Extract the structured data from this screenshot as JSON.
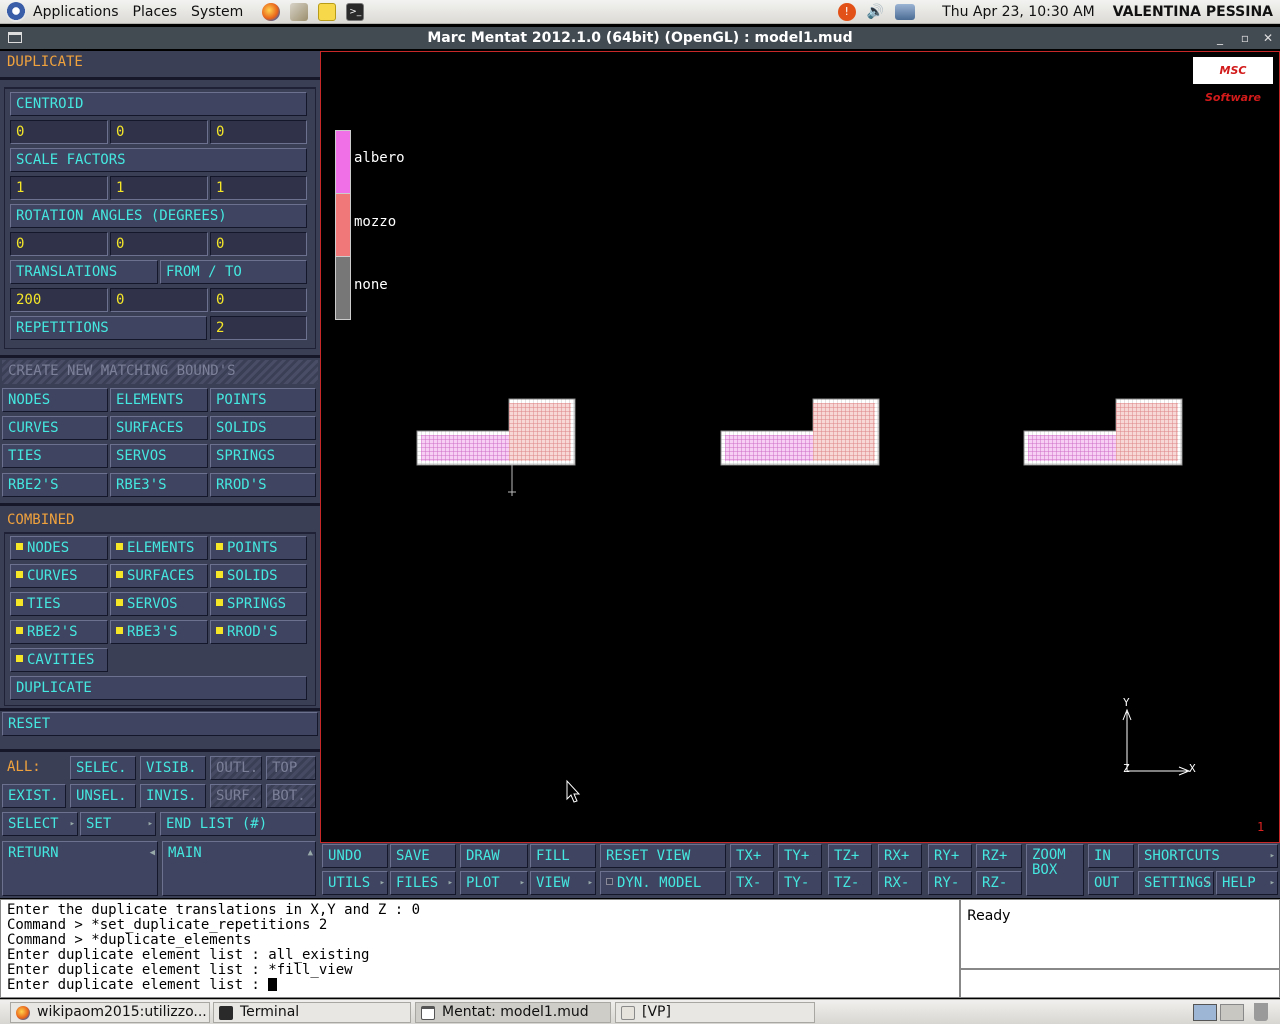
{
  "top_panel": {
    "menus": [
      "Applications",
      "Places",
      "System"
    ],
    "clock": "Thu Apr 23, 10:30 AM",
    "user": "VALENTINA PESSINA"
  },
  "window": {
    "title": "Marc Mentat 2012.1.0 (64bit) (OpenGL) : model1.mud"
  },
  "left": {
    "header": "DUPLICATE",
    "centroid_label": "CENTROID",
    "centroid": [
      "0",
      "0",
      "0"
    ],
    "scale_label": "SCALE FACTORS",
    "scale": [
      "1",
      "1",
      "1"
    ],
    "rotation_label": "ROTATION ANGLES (DEGREES)",
    "rotation": [
      "0",
      "0",
      "0"
    ],
    "translations_label": "TRANSLATIONS",
    "fromto_label": "FROM / TO",
    "translations": [
      "200",
      "0",
      "0"
    ],
    "repetitions_label": "REPETITIONS",
    "repetitions": "2",
    "create_matching": "CREATE NEW MATCHING BOUND'S",
    "entities": [
      "NODES",
      "ELEMENTS",
      "POINTS",
      "CURVES",
      "SURFACES",
      "SOLIDS",
      "TIES",
      "SERVOS",
      "SPRINGS",
      "RBE2'S",
      "RBE3'S",
      "RROD'S"
    ],
    "combined_label": "COMBINED",
    "combined": [
      "NODES",
      "ELEMENTS",
      "POINTS",
      "CURVES",
      "SURFACES",
      "SOLIDS",
      "TIES",
      "SERVOS",
      "SPRINGS",
      "RBE2'S",
      "RBE3'S",
      "RROD'S",
      "CAVITIES"
    ],
    "duplicate_btn": "DUPLICATE",
    "reset": "RESET",
    "all_label": "ALL:",
    "selec": "SELEC.",
    "visib": "VISIB.",
    "outl": "OUTL.",
    "top": "TOP",
    "exist": "EXIST.",
    "unsel": "UNSEL.",
    "invis": "INVIS.",
    "surf": "SURF.",
    "bot": "BOT.",
    "select": "SELECT",
    "set": "SET",
    "end_list": "END LIST (#)",
    "return": "RETURN",
    "main": "MAIN"
  },
  "viewport": {
    "logo": "MSC Software",
    "legend": [
      {
        "label": "albero",
        "color": "#f070e8"
      },
      {
        "label": "mozzo",
        "color": "#f07878"
      },
      {
        "label": "none",
        "color": "#808080"
      }
    ],
    "axis_x": "X",
    "axis_y": "Y",
    "axis_z": "Z",
    "page_number": "1"
  },
  "toolbar": {
    "row1": [
      "UNDO",
      "SAVE",
      "DRAW",
      "FILL",
      "RESET VIEW",
      "TX+",
      "TY+",
      "TZ+",
      "RX+",
      "RY+",
      "RZ+",
      "ZOOM BOX",
      "IN",
      "SHORTCUTS"
    ],
    "row2": [
      "UTILS",
      "FILES",
      "PLOT",
      "VIEW",
      "DYN. MODEL",
      "TX-",
      "TY-",
      "TZ-",
      "RX-",
      "RY-",
      "RZ-",
      "OUT",
      "SETTINGS",
      "HELP"
    ]
  },
  "console": {
    "lines": [
      "Enter the duplicate translations in X,Y and Z : 0",
      "Command > *set_duplicate_repetitions 2",
      "Command > *duplicate_elements",
      "Enter duplicate element list : all_existing",
      "Enter duplicate element list : *fill_view",
      "Enter duplicate element list : "
    ],
    "status": "Ready"
  },
  "taskbar": {
    "tasks": [
      "wikipaom2015:utilizzo...",
      "Terminal",
      "Mentat: model1.mud",
      "[VP]"
    ]
  }
}
